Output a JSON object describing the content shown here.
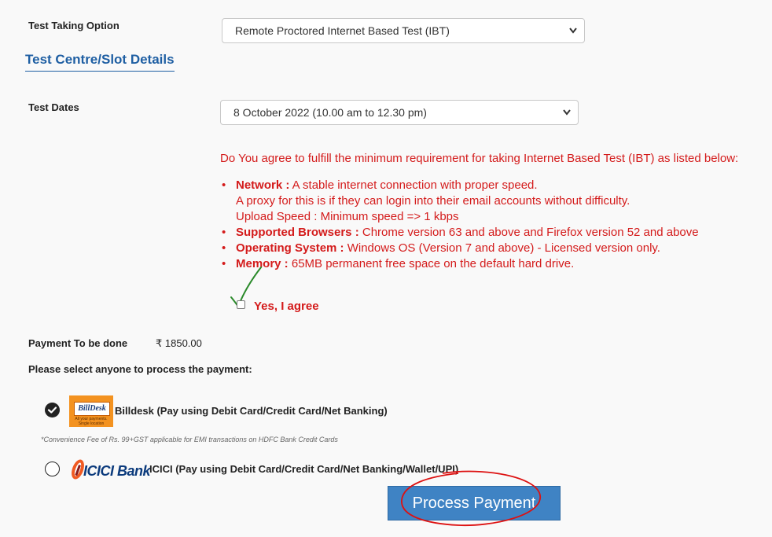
{
  "test_taking": {
    "label": "Test Taking Option",
    "selected": "Remote Proctored Internet Based Test (IBT)"
  },
  "section_title": "Test Centre/Slot Details",
  "test_dates": {
    "label": "Test Dates",
    "selected": "8 October 2022 (10.00 am to 12.30 pm)"
  },
  "requirements": {
    "intro": "Do You agree to fulfill the minimum requirement for taking Internet Based Test (IBT) as listed below:",
    "network": {
      "title": "Network :",
      "line1": " A stable internet connection with proper speed.",
      "line2": "A proxy for this is if they can login into their email accounts without difficulty.",
      "line3": "Upload Speed : Minimum speed => 1 kbps"
    },
    "browsers": {
      "title": "Supported Browsers :",
      "text": " Chrome version 63 and above and Firefox version 52 and above"
    },
    "os": {
      "title": "Operating System :",
      "text": " Windows OS (Version 7 and above) - Licensed version only."
    },
    "memory": {
      "title": "Memory :",
      "text": " 65MB permanent free space on the default hard drive."
    }
  },
  "agree_label": "Yes, I agree",
  "payment": {
    "label": "Payment To be done",
    "amount": "₹ 1850.00",
    "select_msg": "Please select anyone to process the payment:"
  },
  "billdesk": {
    "logo_text": "BillDesk",
    "logo_tag": "All your payments. Single location",
    "label": "Billdesk (Pay using Debit Card/Credit Card/Net Banking)",
    "note": "*Convenience Fee of Rs. 99+GST applicable for EMI transactions on HDFC Bank Credit Cards"
  },
  "icici": {
    "logo_text": "ICICI Bank",
    "label": "ICICI (Pay using Debit Card/Credit Card/Net Banking/Wallet/UPI)"
  },
  "process_button": "Process Payment",
  "colors": {
    "accent_blue": "#1f5fa3",
    "button_blue": "#3f83c4",
    "warning_red": "#d41b1b",
    "annotation_red": "#d11",
    "annotation_green": "#2a8a2a",
    "billdesk_orange": "#f39220",
    "icici_orange": "#f05a22"
  }
}
